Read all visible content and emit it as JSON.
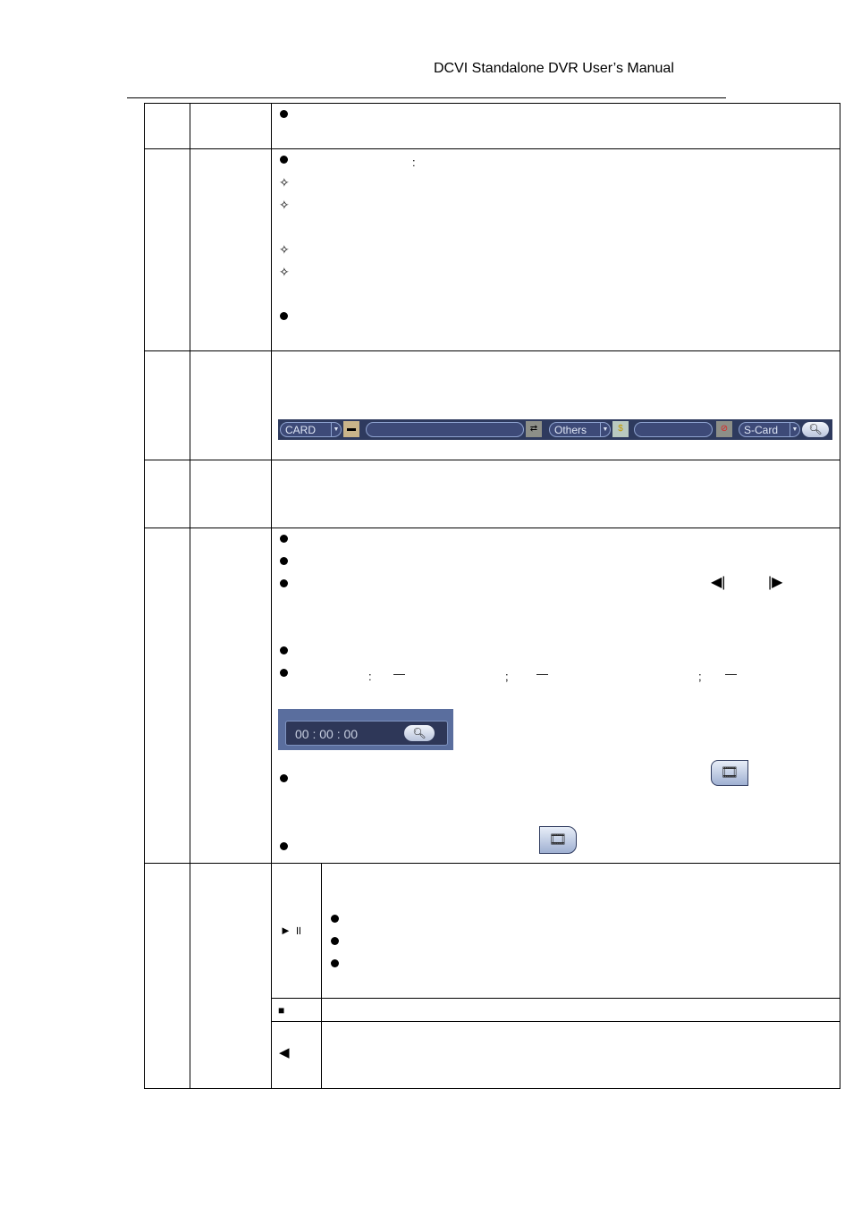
{
  "header": {
    "title": "DCVI Standalone DVR User’s Manual"
  },
  "card_search_bar": {
    "card_type": "CARD",
    "card_number": "",
    "other_type": "Others",
    "other_value": "",
    "storage_type": "S-Card",
    "icons": [
      "card-icon",
      "transaction-icon",
      "money-icon",
      "card-blocked-icon",
      "search-icon"
    ]
  },
  "time_search": {
    "time": "00 : 00 : 00",
    "icon": "search-icon"
  },
  "icons": {
    "file_lock": "film-lock-icon",
    "file_search": "film-search-icon"
  },
  "playback_symbols": {
    "play_pause": "► ॥",
    "stop": "■",
    "backward": "◀",
    "prev_frame": "◀|",
    "next_frame": "|▶"
  },
  "punctuation": {
    "colon": ":",
    "semicolon": ";",
    "dash": "—"
  }
}
